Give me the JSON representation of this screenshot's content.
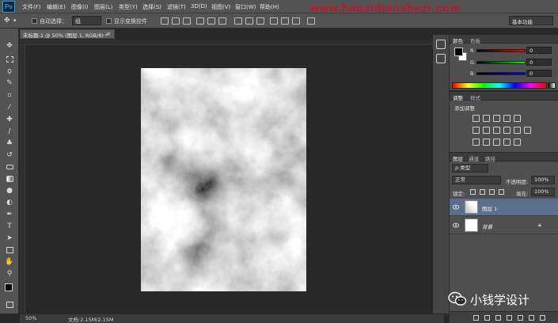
{
  "app": {
    "logo": "Ps",
    "watermark_text": "www.hauzidianshezi.com"
  },
  "menubar": {
    "items": [
      "文件(F)",
      "编辑(E)",
      "图像(I)",
      "图层(L)",
      "类型(Y)",
      "选择(S)",
      "滤镜(T)",
      "3D(D)",
      "视图(V)",
      "窗口(W)",
      "帮助(H)"
    ]
  },
  "options": {
    "auto_select_label": "自动选择：",
    "auto_select_value": "组",
    "transform_label": "显示变换控件",
    "workspace_label": "基本功能"
  },
  "document": {
    "tab_title": "未标题-1 @ 50% (图层 1, RGB/8) *",
    "zoom": "50%",
    "doc_size": "文档:2.15M/2.15M"
  },
  "color_panel": {
    "tabs": [
      "颜色",
      "色板"
    ],
    "channels": [
      {
        "label": "R",
        "value": "0",
        "color_from": "#000000",
        "color_to": "#ff0000"
      },
      {
        "label": "G",
        "value": "0",
        "color_from": "#000000",
        "color_to": "#00ff00"
      },
      {
        "label": "B",
        "value": "0",
        "color_from": "#000000",
        "color_to": "#0000ff"
      }
    ],
    "foreground": "#000000",
    "background": "#ffffff"
  },
  "adjust_panel": {
    "tabs": [
      "调整",
      "样式"
    ],
    "add_adjustment": "添加调整"
  },
  "layers_panel": {
    "tabs": [
      "图层",
      "通道",
      "路径"
    ],
    "filter_label": "ρ 类型",
    "blend_mode": "正常",
    "opacity_label": "不透明度:",
    "opacity_value": "100%",
    "lock_label": "锁定:",
    "fill_label": "填充:",
    "fill_value": "100%",
    "layers": [
      {
        "name": "图层 1",
        "selected": true
      },
      {
        "name": "背景",
        "selected": false
      }
    ]
  },
  "wechat_watermark": {
    "text": "小钱学设计"
  }
}
